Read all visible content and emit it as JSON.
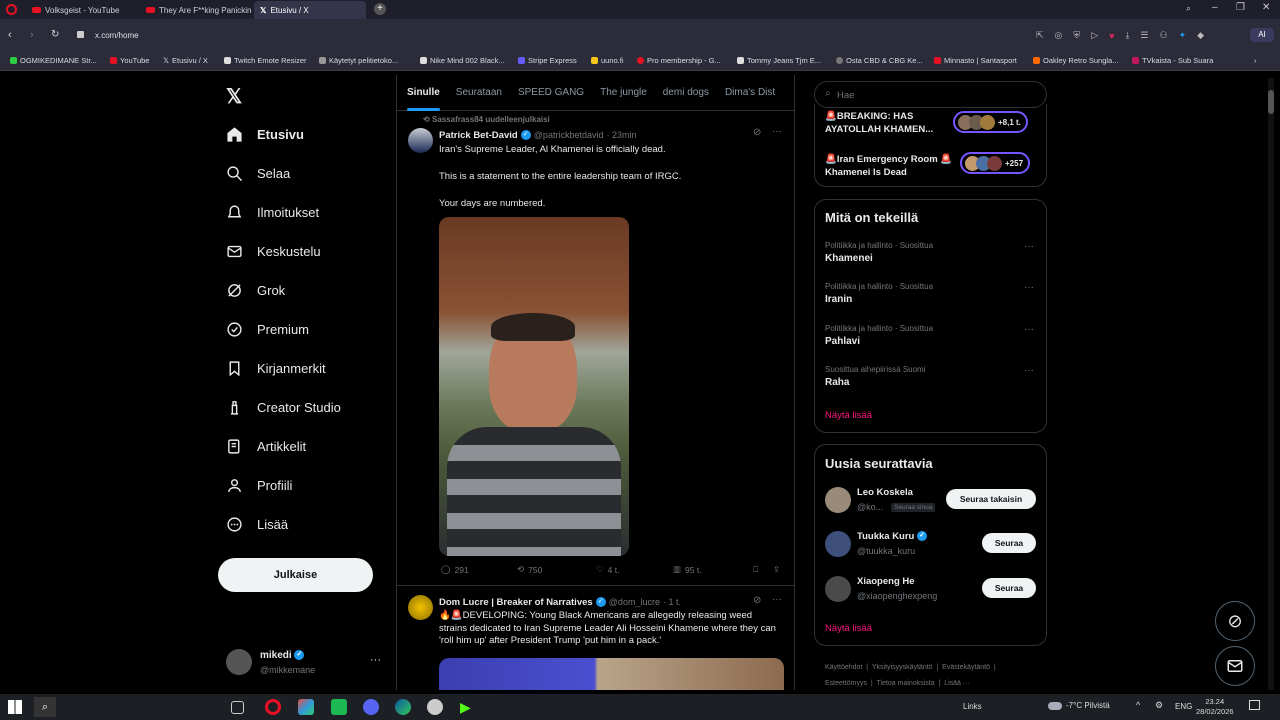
{
  "browser": {
    "tabs": [
      "Volksgeist - YouTube",
      "They Are F**king Panicking",
      "Etusivu / X"
    ],
    "url": "x.com/home",
    "bookmarks": [
      "OGMIKEDIMANE Str...",
      "YouTube",
      "Etusivu / X",
      "Twitch Emote Resizer",
      "Käytetyt pelitietoko...",
      "Nike Mind 002 Black...",
      "Stripe Express",
      "uuno.fi",
      "Pro membership - G...",
      "Tommy Jeans Tjm E...",
      "Osta CBD & CBG Ke...",
      "Minnasto | Santasport",
      "Oakley Retro Sungla...",
      "TVkaista - Sub Suara"
    ],
    "ai_label": "AI"
  },
  "nav": {
    "items": [
      "Etusivu",
      "Selaa",
      "Ilmoitukset",
      "Keskustelu",
      "Grok",
      "Premium",
      "Kirjanmerkit",
      "Creator Studio",
      "Artikkelit",
      "Profiili",
      "Lisää"
    ],
    "post_label": "Julkaise",
    "user": {
      "name": "mikedi",
      "handle": "@mikkemane",
      "more": "···"
    }
  },
  "feed": {
    "tabs": [
      "Sinulle",
      "Seurataan",
      "SPEED GANG",
      "The jungle",
      "demi dogs",
      "Dima's Dist"
    ],
    "tweet1": {
      "repost_note": "Sassafrass84 uudelleenjulkaisi",
      "name": "Patrick Bet-David",
      "handle": "@patrickbetdavid",
      "time": "· 23min",
      "lines": [
        "Iran's Supreme Leader, Al Khamenei is officially dead.",
        "This is a statement to the entire leadership team of IRGC.",
        "Your days are numbered."
      ],
      "replies": "291",
      "reposts": "750",
      "likes": "4 t.",
      "views": "95 t."
    },
    "tweet2": {
      "name": "Dom Lucre | Breaker of Narratives",
      "handle": "@dom_lucre",
      "time": "· 1 t.",
      "text": "🔥🚨DEVELOPING: Young Black Americans are allegedly releasing weed strains dedicated to Iran Supreme Leader Ali Hosseini Khamene where they can 'roll him up' after President Trump 'put him in a pack.'"
    }
  },
  "right": {
    "search_placeholder": "Hae",
    "news": [
      {
        "title": "🚨BREAKING: HAS AYATOLLAH KHAMEN...",
        "count": "+8,1 t."
      },
      {
        "title": "🚨Iran Emergency Room 🚨 Khamenei Is Dead",
        "count": "+257"
      }
    ],
    "trends_title": "Mitä on tekeillä",
    "trends": [
      {
        "category": "Politiikka ja hallinto · Suosittua",
        "name": "Khamenei"
      },
      {
        "category": "Politiikka ja hallinto · Suosittua",
        "name": "Iranin"
      },
      {
        "category": "Politiikka ja hallinto · Suosittua",
        "name": "Pahlavi"
      },
      {
        "category": "Suosittua aihepiirissä Suomi",
        "name": "Raha"
      }
    ],
    "show_more": "Näytä lisää",
    "follow_title": "Uusia seurattavia",
    "follow": [
      {
        "name": "Leo Koskela",
        "handle": "@ko...",
        "badge": "Seuraa sinua",
        "button": "Seuraa takaisin"
      },
      {
        "name": "Tuukka Kuru",
        "handle": "@tuukka_kuru",
        "button": "Seuraa"
      },
      {
        "name": "Xiaopeng He",
        "handle": "@xiaopenghexpeng",
        "button": "Seuraa"
      }
    ],
    "footer": [
      "Käyttöehdot",
      "Yksityisyyskäytäntö",
      "Evästekäytäntö",
      "Esteettömyys",
      "Tietoa mainoksista",
      "Lisää ···"
    ]
  },
  "taskbar": {
    "links": "Links",
    "weather": "-7°C Pilvistä",
    "lang": "ENG",
    "time": "23.24",
    "date": "28/02/2026"
  }
}
